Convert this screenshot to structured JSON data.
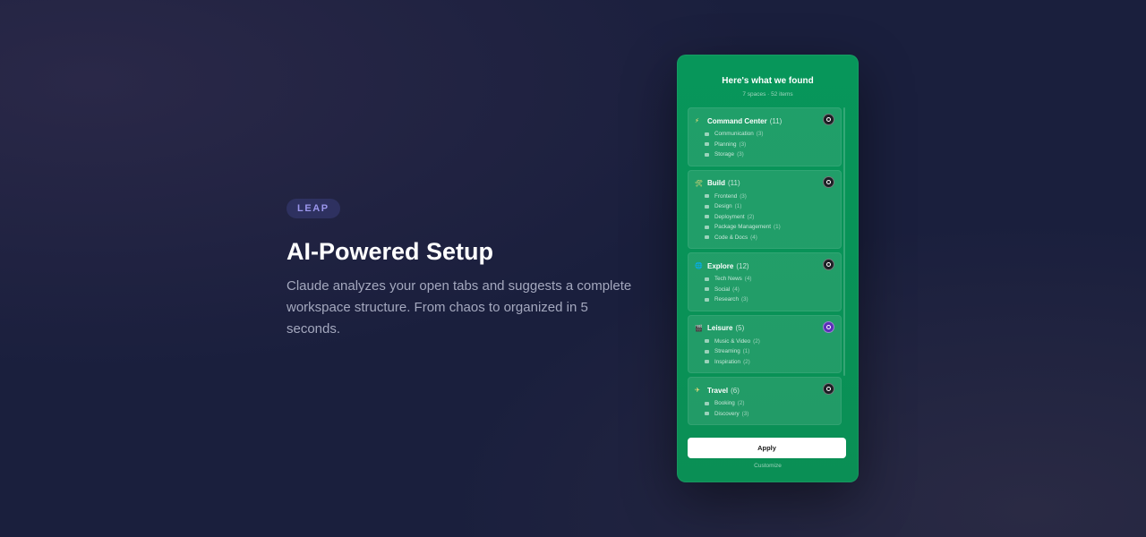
{
  "hero": {
    "tag": "LEAP",
    "title": "AI-Powered Setup",
    "description": "Claude analyzes your open tabs and suggests a complete workspace structure. From chaos to organized in 5 seconds."
  },
  "panel": {
    "title": "Here's what we found",
    "subtitle": "7 spaces · 52 items",
    "spaces": [
      {
        "emoji": "⚡",
        "name": "Command Center",
        "count": "(11)",
        "action": "dark",
        "folders": [
          {
            "name": "Communication",
            "count": "(3)"
          },
          {
            "name": "Planning",
            "count": "(3)"
          },
          {
            "name": "Storage",
            "count": "(3)"
          }
        ]
      },
      {
        "emoji": "🛠",
        "name": "Build",
        "count": "(11)",
        "action": "dark",
        "folders": [
          {
            "name": "Frontend",
            "count": "(3)"
          },
          {
            "name": "Design",
            "count": "(1)"
          },
          {
            "name": "Deployment",
            "count": "(2)"
          },
          {
            "name": "Package Management",
            "count": "(1)"
          },
          {
            "name": "Code & Docs",
            "count": "(4)"
          }
        ]
      },
      {
        "emoji": "🌐",
        "name": "Explore",
        "count": "(12)",
        "action": "dark",
        "folders": [
          {
            "name": "Tech News",
            "count": "(4)"
          },
          {
            "name": "Social",
            "count": "(4)"
          },
          {
            "name": "Research",
            "count": "(3)"
          }
        ]
      },
      {
        "emoji": "🎬",
        "name": "Leisure",
        "count": "(5)",
        "action": "purple",
        "folders": [
          {
            "name": "Music & Video",
            "count": "(2)"
          },
          {
            "name": "Streaming",
            "count": "(1)"
          },
          {
            "name": "Inspiration",
            "count": "(2)"
          }
        ]
      },
      {
        "emoji": "✈",
        "name": "Travel",
        "count": "(6)",
        "action": "dark",
        "folders": [
          {
            "name": "Booking",
            "count": "(2)"
          },
          {
            "name": "Discovery",
            "count": "(3)"
          }
        ]
      }
    ],
    "apply_label": "Apply",
    "customize_label": "Customize"
  },
  "colors": {
    "background": "#1a1f3d",
    "panel_green": "#07965a",
    "tag_background": "#2e3160",
    "tag_text": "#9b96ec",
    "action_purple": "#5b2fb8"
  }
}
